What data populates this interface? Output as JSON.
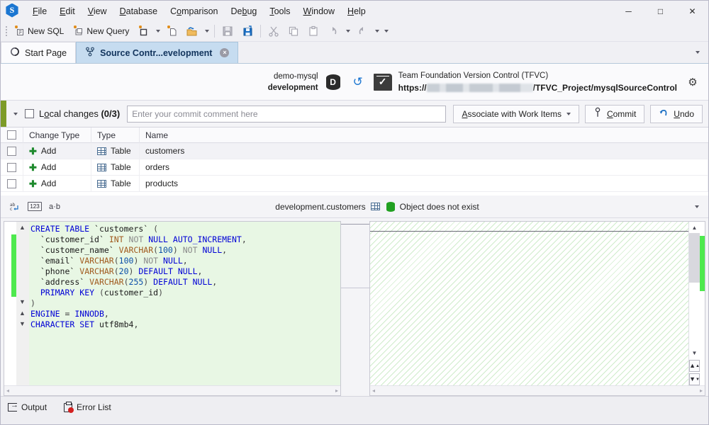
{
  "app": {
    "logo_letter": "S",
    "logo_icon": "app-logo-hexagon"
  },
  "menubar": {
    "items": [
      {
        "label": "File"
      },
      {
        "label": "Edit"
      },
      {
        "label": "View"
      },
      {
        "label": "Database"
      },
      {
        "label": "Comparison"
      },
      {
        "label": "Debug"
      },
      {
        "label": "Tools"
      },
      {
        "label": "Window"
      },
      {
        "label": "Help"
      }
    ]
  },
  "window_controls": {
    "minimize": "─",
    "maximize": "□",
    "close": "✕"
  },
  "toolbar": {
    "new_sql_label": "New SQL",
    "new_query_label": "New Query",
    "icons": [
      "new-sql-icon",
      "new-query-icon",
      "new-project-icon",
      "new-file-icon",
      "open-folder-icon",
      "save-icon",
      "save-all-icon",
      "cut-icon",
      "copy-icon",
      "paste-icon",
      "undo-icon",
      "redo-icon"
    ]
  },
  "tabs": {
    "items": [
      {
        "label": "Start Page",
        "icon": "start-page-icon",
        "active": false,
        "closable": false
      },
      {
        "label": "Source Contr...evelopment",
        "icon": "source-control-icon",
        "active": true,
        "closable": true
      }
    ],
    "close_glyph": "×",
    "overflow_glyph": "▾"
  },
  "connection_header": {
    "db_server": "demo-mysql",
    "db_name": "development",
    "db_icon_letter": "D",
    "refresh_glyph": "↺",
    "provider_icon": "tfvc-checkmark-icon",
    "provider_label": "Team Foundation Version Control (TFVC)",
    "repo_url_prefix": "https://",
    "repo_url_redacted": "",
    "repo_url_suffix": "/TFVC_Project/mysqlSourceControl",
    "settings_glyph": "⚙"
  },
  "commit_bar": {
    "expander_glyph": "▾",
    "local_changes_label": "Local changes (0/3)",
    "local_changes_text": "Local changes ",
    "local_changes_count": "(0/3)",
    "comment_placeholder": "Enter your commit comment here",
    "comment_value": "",
    "associate_label": "Associate with Work Items",
    "associate_caret": "▾",
    "commit_label": "Commit",
    "commit_icon": "commit-pin-icon",
    "undo_label": "Undo",
    "undo_icon": "undo-arrow-icon",
    "accent_color": "#7d9b28"
  },
  "changes_grid": {
    "columns": [
      "",
      "Change Type",
      "Type",
      "Name"
    ],
    "rows": [
      {
        "checked": false,
        "change_type": "Add",
        "type": "Table",
        "name": "customers",
        "selected": true
      },
      {
        "checked": false,
        "change_type": "Add",
        "type": "Table",
        "name": "orders",
        "selected": false
      },
      {
        "checked": false,
        "change_type": "Add",
        "type": "Table",
        "name": "products",
        "selected": false
      }
    ],
    "add_glyph": "✚"
  },
  "diff_toolbar": {
    "icons": [
      "word-wrap-icon",
      "line-numbers-icon",
      "whitespace-icon"
    ],
    "line_numbers_glyph": "123",
    "whitespace_glyph": "a·b",
    "object_name": "development.customers",
    "object_icon": "table-icon",
    "status_icon": "database-green-icon",
    "status_text": "Object does not exist",
    "overflow_glyph": "▾"
  },
  "diff_editor": {
    "left_lines": [
      {
        "indent": 0,
        "fold": "collapse",
        "tokens": [
          {
            "t": "CREATE",
            "c": "kw"
          },
          {
            "t": " ",
            "c": ""
          },
          {
            "t": "TABLE",
            "c": "kw"
          },
          {
            "t": " ",
            "c": ""
          },
          {
            "t": "`customers`",
            "c": "ident"
          },
          {
            "t": " ",
            "c": ""
          },
          {
            "t": "(",
            "c": "paren"
          }
        ]
      },
      {
        "indent": 1,
        "fold": "",
        "tokens": [
          {
            "t": "`customer_id`",
            "c": "ident"
          },
          {
            "t": " ",
            "c": ""
          },
          {
            "t": "INT",
            "c": "type"
          },
          {
            "t": " ",
            "c": ""
          },
          {
            "t": "NOT",
            "c": "mod"
          },
          {
            "t": " ",
            "c": ""
          },
          {
            "t": "NULL",
            "c": "kw"
          },
          {
            "t": " ",
            "c": ""
          },
          {
            "t": "AUTO_INCREMENT",
            "c": "kw"
          },
          {
            "t": ",",
            "c": "punct"
          }
        ]
      },
      {
        "indent": 1,
        "fold": "",
        "tokens": [
          {
            "t": "`customer_name`",
            "c": "ident"
          },
          {
            "t": " ",
            "c": ""
          },
          {
            "t": "VARCHAR",
            "c": "type"
          },
          {
            "t": "(",
            "c": "paren"
          },
          {
            "t": "100",
            "c": "num"
          },
          {
            "t": ")",
            "c": "paren"
          },
          {
            "t": " ",
            "c": ""
          },
          {
            "t": "NOT",
            "c": "mod"
          },
          {
            "t": " ",
            "c": ""
          },
          {
            "t": "NULL",
            "c": "kw"
          },
          {
            "t": ",",
            "c": "punct"
          }
        ]
      },
      {
        "indent": 1,
        "fold": "",
        "tokens": [
          {
            "t": "`email`",
            "c": "ident"
          },
          {
            "t": " ",
            "c": ""
          },
          {
            "t": "VARCHAR",
            "c": "type"
          },
          {
            "t": "(",
            "c": "paren"
          },
          {
            "t": "100",
            "c": "num"
          },
          {
            "t": ")",
            "c": "paren"
          },
          {
            "t": " ",
            "c": ""
          },
          {
            "t": "NOT",
            "c": "mod"
          },
          {
            "t": " ",
            "c": ""
          },
          {
            "t": "NULL",
            "c": "kw"
          },
          {
            "t": ",",
            "c": "punct"
          }
        ]
      },
      {
        "indent": 1,
        "fold": "",
        "tokens": [
          {
            "t": "`phone`",
            "c": "ident"
          },
          {
            "t": " ",
            "c": ""
          },
          {
            "t": "VARCHAR",
            "c": "type"
          },
          {
            "t": "(",
            "c": "paren"
          },
          {
            "t": "20",
            "c": "num"
          },
          {
            "t": ")",
            "c": "paren"
          },
          {
            "t": " ",
            "c": ""
          },
          {
            "t": "DEFAULT",
            "c": "kw"
          },
          {
            "t": " ",
            "c": ""
          },
          {
            "t": "NULL",
            "c": "kw"
          },
          {
            "t": ",",
            "c": "punct"
          }
        ]
      },
      {
        "indent": 1,
        "fold": "",
        "tokens": [
          {
            "t": "`address`",
            "c": "ident"
          },
          {
            "t": " ",
            "c": ""
          },
          {
            "t": "VARCHAR",
            "c": "type"
          },
          {
            "t": "(",
            "c": "paren"
          },
          {
            "t": "255",
            "c": "num"
          },
          {
            "t": ")",
            "c": "paren"
          },
          {
            "t": " ",
            "c": ""
          },
          {
            "t": "DEFAULT",
            "c": "kw"
          },
          {
            "t": " ",
            "c": ""
          },
          {
            "t": "NULL",
            "c": "kw"
          },
          {
            "t": ",",
            "c": "punct"
          }
        ]
      },
      {
        "indent": 1,
        "fold": "",
        "tokens": [
          {
            "t": "PRIMARY",
            "c": "kw"
          },
          {
            "t": " ",
            "c": ""
          },
          {
            "t": "KEY",
            "c": "kw"
          },
          {
            "t": " ",
            "c": ""
          },
          {
            "t": "(",
            "c": "paren"
          },
          {
            "t": "customer_id",
            "c": "ident"
          },
          {
            "t": ")",
            "c": "paren"
          }
        ]
      },
      {
        "indent": 0,
        "fold": "expand",
        "tokens": [
          {
            "t": ")",
            "c": "paren"
          }
        ]
      },
      {
        "indent": 0,
        "fold": "up",
        "tokens": [
          {
            "t": "ENGINE",
            "c": "kw"
          },
          {
            "t": " ",
            "c": ""
          },
          {
            "t": "=",
            "c": "punct"
          },
          {
            "t": " ",
            "c": ""
          },
          {
            "t": "INNODB",
            "c": "kw"
          },
          {
            "t": ",",
            "c": "punct"
          }
        ]
      },
      {
        "indent": 0,
        "fold": "down",
        "tokens": [
          {
            "t": "CHARACTER",
            "c": "kw"
          },
          {
            "t": " ",
            "c": ""
          },
          {
            "t": "SET",
            "c": "kw"
          },
          {
            "t": " ",
            "c": ""
          },
          {
            "t": "utf8mb4",
            "c": "ident"
          },
          {
            "t": ",",
            "c": "punct"
          }
        ]
      }
    ],
    "right_lines": [],
    "right_empty": true,
    "scroll_up_glyph": "▲",
    "scroll_down_glyph": "▼",
    "next_diff_glyph": "⮝",
    "prev_diff_glyph": "⮟",
    "hscroll_left_glyph": "◂",
    "hscroll_right_glyph": "▸"
  },
  "bottom_dock": {
    "tabs": [
      {
        "label": "Output",
        "icon": "output-icon"
      },
      {
        "label": "Error List",
        "icon": "error-list-icon"
      }
    ]
  },
  "colors": {
    "accent_green": "#7d9b28",
    "added_line_bg": "#e8f7e4",
    "change_marker": "#4ee94e",
    "tab_active_bg": "#c6dcf0",
    "keyword_blue": "#0000d6",
    "type_orange": "#a05a1e",
    "number_blue": "#0b4fa8",
    "add_plus_green": "#1f8a2e",
    "error_red": "#d32020",
    "status_db_green": "#21a021"
  }
}
